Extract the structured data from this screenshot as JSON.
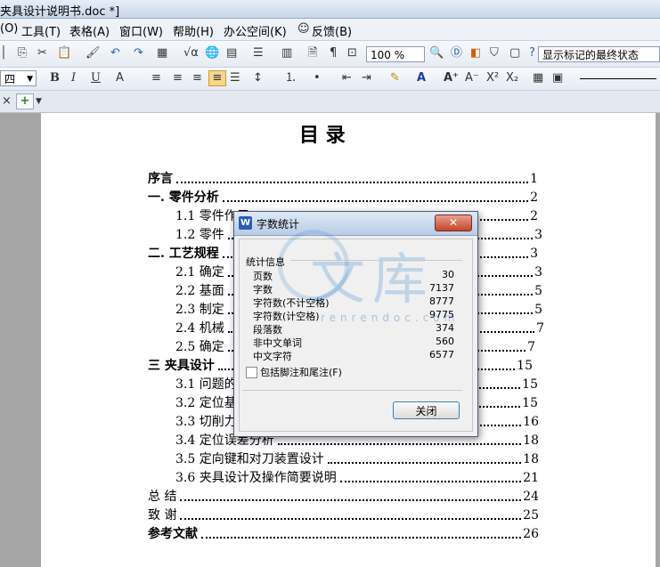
{
  "window": {
    "title": "夹具设计说明书.doc *]"
  },
  "menu": [
    "(O)",
    "工具(T)",
    "表格(A)",
    "窗口(W)",
    "帮助(H)",
    "办公空间(K)",
    "反馈(B)"
  ],
  "toolbar1": {
    "zoom": "100 %",
    "markup_mode": "显示标记的最终状态"
  },
  "toolbar2": {
    "font_size": "四",
    "bold": "B",
    "italic": "I",
    "underline": "U",
    "superscript": "X²",
    "subscript": "X₂"
  },
  "doc": {
    "title": "目    录",
    "toc": [
      {
        "label": "序言",
        "page": "1",
        "bold": true
      },
      {
        "label": "一.  零件分析",
        "page": "2",
        "bold": true
      },
      {
        "label": "1.1  零件作用",
        "page": "2",
        "bold": false
      },
      {
        "label": "1.2 零件",
        "page": "3",
        "bold": false
      },
      {
        "label": "二.  工艺规程",
        "page": "3",
        "bold": true
      },
      {
        "label": "2.1 确定",
        "page": "3",
        "bold": false
      },
      {
        "label": "2.2 基面",
        "page": "5",
        "bold": false
      },
      {
        "label": "2.3 制定",
        "page": "5",
        "bold": false
      },
      {
        "label": "2.4 机械",
        "page": "7",
        "bold": false
      },
      {
        "label": "2.5 确定",
        "page": "7",
        "bold": false
      },
      {
        "label": "三   夹具设计",
        "page": "15",
        "bold": true
      },
      {
        "label": "3.1 问题的",
        "page": "15",
        "bold": false
      },
      {
        "label": "3.2 定位基",
        "page": "15",
        "bold": false
      },
      {
        "label": "3.3 切削力",
        "page": "16",
        "bold": false
      },
      {
        "label": "3.4 定位误差分析",
        "page": "18",
        "bold": false
      },
      {
        "label": "3.5 定向键和对刀装置设计",
        "page": "18",
        "bold": false
      },
      {
        "label": "3.6 夹具设计及操作简要说明",
        "page": "21",
        "bold": false
      },
      {
        "label": "总  结",
        "page": "24",
        "bold": false
      },
      {
        "label": "致  谢",
        "page": "25",
        "bold": false
      },
      {
        "label": "参考文献",
        "page": "26",
        "bold": true
      }
    ]
  },
  "dialog": {
    "title": "字数统计",
    "close_x": "✕",
    "group_label": "统计信息",
    "stats": [
      {
        "k": "页数",
        "v": "30"
      },
      {
        "k": "字数",
        "v": "7137"
      },
      {
        "k": "字符数(不计空格)",
        "v": "8777"
      },
      {
        "k": "字符数(计空格)",
        "v": "9775"
      },
      {
        "k": "段落数",
        "v": "374"
      },
      {
        "k": "非中文单词",
        "v": "560"
      },
      {
        "k": "中文字符",
        "v": "6577"
      }
    ],
    "checkbox_label": "包括脚注和尾注(F)",
    "close_button": "关闭"
  },
  "watermark": {
    "text": "文库",
    "url": "renrendoc.com"
  }
}
